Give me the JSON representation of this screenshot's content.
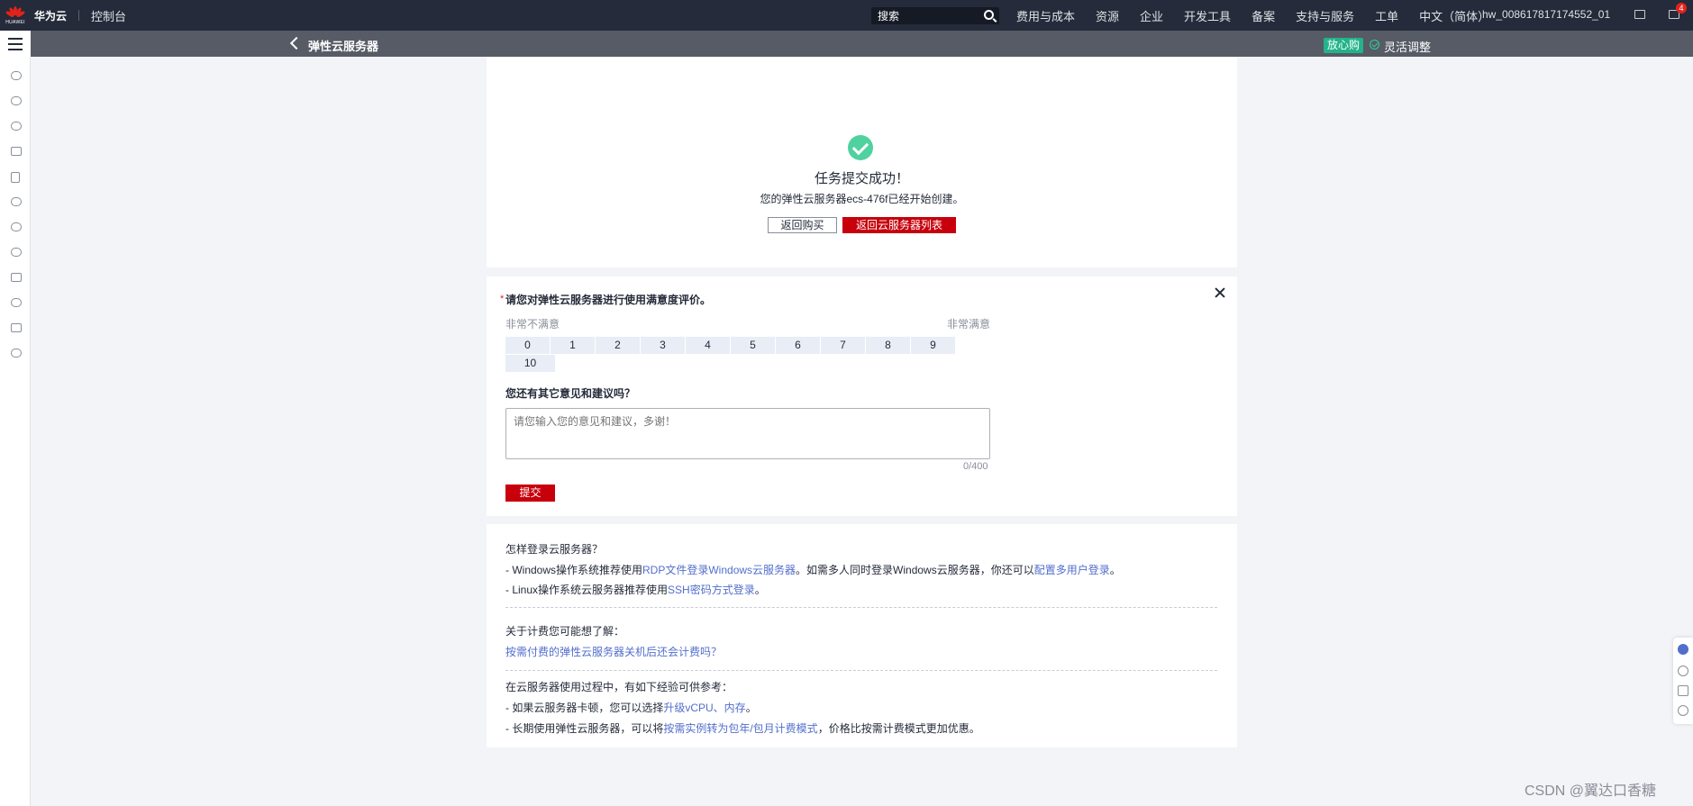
{
  "topbar": {
    "brand": "华为云",
    "console": "控制台",
    "search_placeholder": "搜索",
    "nav": [
      "费用与成本",
      "资源",
      "企业",
      "开发工具",
      "备案",
      "支持与服务",
      "工单",
      "中文（简体）"
    ],
    "account": "hw_008617817174552_01",
    "notifications_count": "4",
    "logo_caption": "HUAWEI"
  },
  "subheader": {
    "title": "弹性云服务器",
    "promo_badge": "放心购",
    "flex_label": "灵活调整"
  },
  "success": {
    "title": "任务提交成功！",
    "description": "您的弹性云服务器ecs-476f已经开始创建。",
    "back_button": "返回购买",
    "list_button": "返回云服务器列表"
  },
  "survey": {
    "required_mark": "*",
    "question": "请您对弹性云服务器进行使用满意度评价。",
    "low_label": "非常不满意",
    "high_label": "非常满意",
    "scores": [
      "0",
      "1",
      "2",
      "3",
      "4",
      "5",
      "6",
      "7",
      "8",
      "9",
      "10"
    ],
    "feedback_question": "您还有其它意见和建议吗？",
    "feedback_placeholder": "请您输入您的意见和建议，多谢！",
    "counter": "0/400",
    "submit": "提交"
  },
  "help": {
    "login_title": "怎样登录云服务器？",
    "win_prefix": "- Windows操作系统推荐使用",
    "win_link": "RDP文件登录Windows云服务器",
    "win_mid": "。如需多人同时登录Windows云服务器，你还可以",
    "win_link2": "配置多用户登录",
    "win_end": "。",
    "linux_prefix": "- Linux操作系统云服务器推荐使用",
    "linux_link": "SSH密码方式登录",
    "linux_end": "。",
    "billing_title": "关于计费您可能想了解：",
    "billing_link": "按需付费的弹性云服务器关机后还会计费吗？",
    "exp_title": "在云服务器使用过程中，有如下经验可供参考：",
    "exp1_prefix": "- 如果云服务器卡顿，您可以选择",
    "exp1_link": "升级vCPU、内存",
    "exp1_end": "。",
    "exp2_prefix": "- 长期使用弹性云服务器，可以将",
    "exp2_link": "按需实例转为包年/包月计费模式",
    "exp2_end": "，价格比按需计费模式更加优惠。"
  },
  "watermark": "CSDN @翼达口香糖"
}
